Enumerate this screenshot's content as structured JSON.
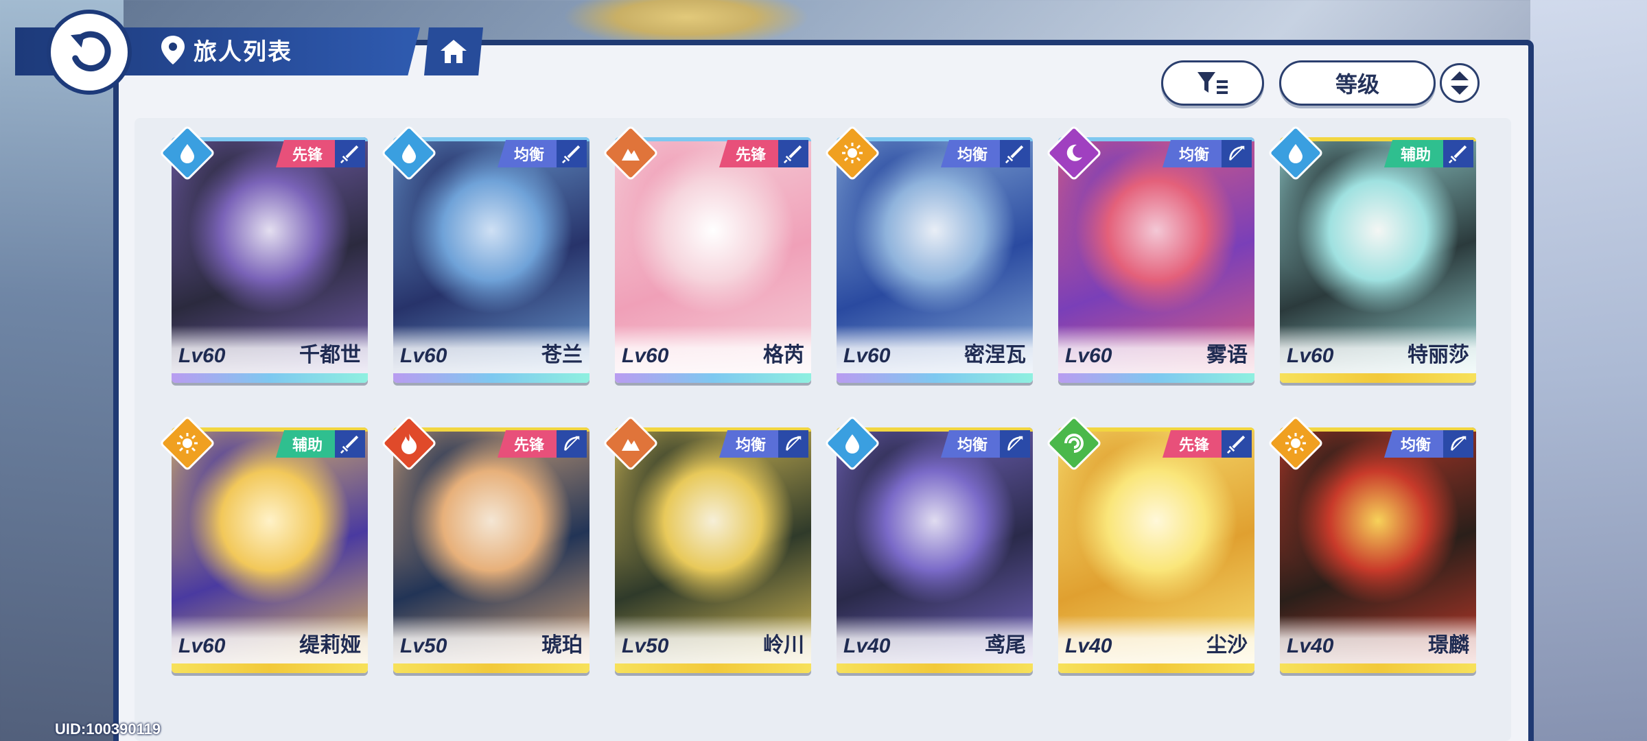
{
  "header": {
    "title": "旅人列表",
    "back_icon": "back-arrow-icon",
    "location_icon": "location-pin-icon",
    "home_icon": "home-icon"
  },
  "toolbar": {
    "filter_icon": "filter-icon",
    "sort_label": "等级",
    "order_icon": "sort-order-icon"
  },
  "colors": {
    "panel_border": "#203a73",
    "role_vanguard": "#e8507a",
    "role_balance": "#5a6fd8",
    "role_support": "#2fbf8f",
    "element_water": "#3a9fe0",
    "element_earth": "#e0743a",
    "element_light": "#f0a020",
    "element_dark": "#a040c0",
    "element_fire": "#e04a2a",
    "element_wind": "#4ab84a"
  },
  "characters": [
    {
      "name": "千都世",
      "level": "Lv60",
      "role": "先锋",
      "element": "water",
      "weapon": "sword",
      "rarity_color": "#7ec8f0",
      "art_a": "#2b2a3e",
      "art_b": "#7a63b8",
      "art_c": "#e4dff0"
    },
    {
      "name": "苍兰",
      "level": "Lv60",
      "role": "均衡",
      "element": "water",
      "weapon": "sword",
      "rarity_color": "#7ec8f0",
      "art_a": "#27336a",
      "art_b": "#6fa2d8",
      "art_c": "#cfe0f4"
    },
    {
      "name": "格芮",
      "level": "Lv60",
      "role": "先锋",
      "element": "earth",
      "weapon": "sword",
      "rarity_color": "#7ec8f0",
      "art_a": "#f0a0b8",
      "art_b": "#f6d5dd",
      "art_c": "#ffffff"
    },
    {
      "name": "密涅瓦",
      "level": "Lv60",
      "role": "均衡",
      "element": "light",
      "weapon": "sword",
      "rarity_color": "#7ec8f0",
      "art_a": "#2a4aa0",
      "art_b": "#8fb3dc",
      "art_c": "#e9eef6"
    },
    {
      "name": "雾语",
      "level": "Lv60",
      "role": "均衡",
      "element": "dark",
      "weapon": "bow",
      "rarity_color": "#7ec8f0",
      "art_a": "#7a3fb8",
      "art_b": "#e4607a",
      "art_c": "#f3c8d6"
    },
    {
      "name": "特丽莎",
      "level": "Lv60",
      "role": "辅助",
      "element": "water",
      "weapon": "sword",
      "rarity_color": "#f2d640",
      "art_a": "#2b3a3c",
      "art_b": "#9fe1e0",
      "art_c": "#f4f6f4"
    },
    {
      "name": "缇莉娅",
      "level": "Lv60",
      "role": "辅助",
      "element": "light",
      "weapon": "sword",
      "rarity_color": "#f2d640",
      "art_a": "#4a3aa0",
      "art_b": "#f2c85a",
      "art_c": "#fff2c8"
    },
    {
      "name": "琥珀",
      "level": "Lv50",
      "role": "先锋",
      "element": "fire",
      "weapon": "bow",
      "rarity_color": "#f2d640",
      "art_a": "#223456",
      "art_b": "#e7b07a",
      "art_c": "#f4e6d4"
    },
    {
      "name": "岭川",
      "level": "Lv50",
      "role": "均衡",
      "element": "earth",
      "weapon": "bow",
      "rarity_color": "#f2d640",
      "art_a": "#2f3a2a",
      "art_b": "#e8c95a",
      "art_c": "#f6efd8"
    },
    {
      "name": "鸢尾",
      "level": "Lv40",
      "role": "均衡",
      "element": "water",
      "weapon": "bow",
      "rarity_color": "#f2d640",
      "art_a": "#2a2a4a",
      "art_b": "#7a6ac8",
      "art_c": "#e0dcf0"
    },
    {
      "name": "尘沙",
      "level": "Lv40",
      "role": "先锋",
      "element": "wind",
      "weapon": "sword",
      "rarity_color": "#f2d640",
      "art_a": "#e0a030",
      "art_b": "#fae67a",
      "art_c": "#fff8da"
    },
    {
      "name": "璟麟",
      "level": "Lv40",
      "role": "均衡",
      "element": "light",
      "weapon": "bow",
      "rarity_color": "#f2d640",
      "art_a": "#2a1f1a",
      "art_b": "#c83a2a",
      "art_c": "#f7d25a"
    }
  ],
  "footer": {
    "uid": "UID:100390119"
  }
}
